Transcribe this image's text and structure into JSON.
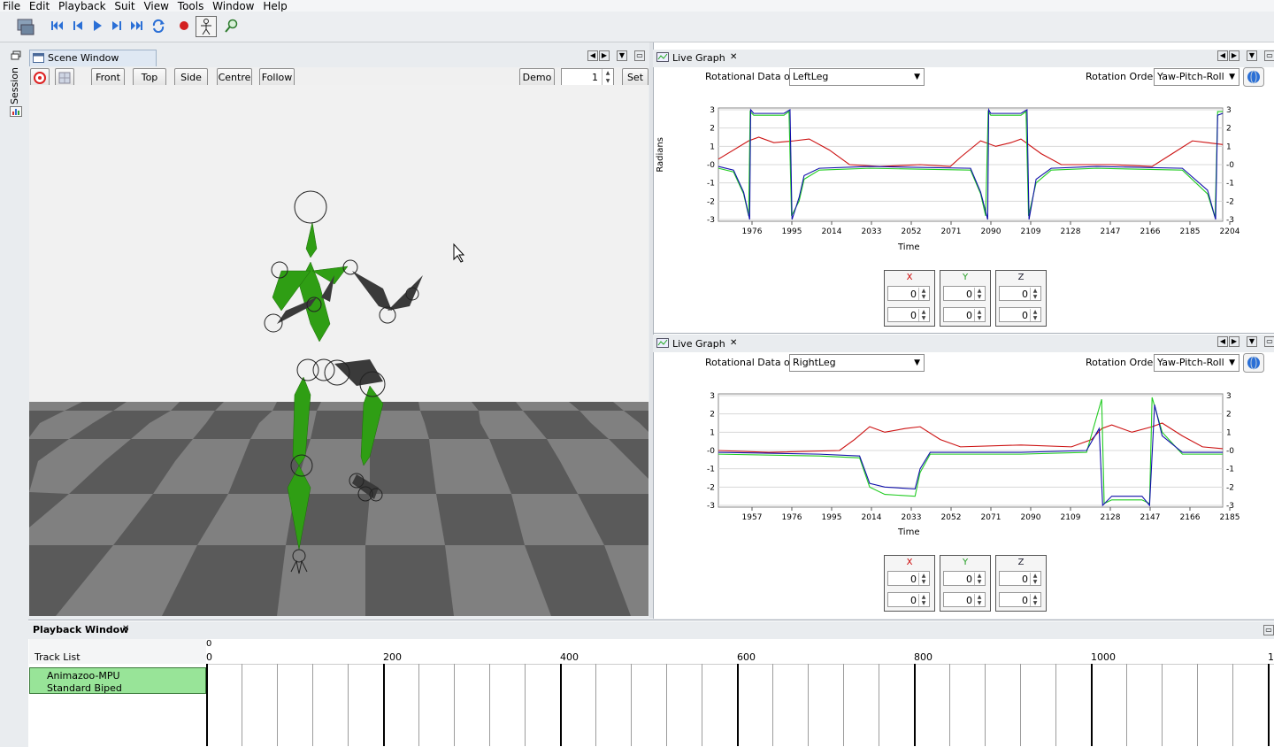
{
  "menu": [
    "File",
    "Edit",
    "Playback",
    "Suit",
    "View",
    "Tools",
    "Window",
    "Help"
  ],
  "sidebar": {
    "session_label": "Session"
  },
  "scene": {
    "tab_title": "Scene Window",
    "buttons": {
      "front": "Front",
      "top": "Top",
      "side": "Side",
      "centre": "Centre",
      "follow": "Follow",
      "demo": "Demo",
      "set": "Set"
    },
    "frame_value": "1"
  },
  "graph1": {
    "tab_title": "Live Graph",
    "rot_label": "Rotational Data of",
    "segment": "LeftLeg",
    "order_label": "Rotation Order",
    "order_value": "Yaw-Pitch-Roll",
    "ylabel": "Radians",
    "xlabel": "Time",
    "y_ticks": [
      "3",
      "2",
      "1",
      "-0",
      "-1",
      "-2",
      "-3"
    ],
    "x_ticks": [
      "1976",
      "1995",
      "2014",
      "2033",
      "2052",
      "2071",
      "2090",
      "2109",
      "2128",
      "2147",
      "2166",
      "2185",
      "2204"
    ],
    "xyz": {
      "x": "X",
      "y": "Y",
      "z": "Z",
      "vals": [
        "0",
        "0",
        "0",
        "0",
        "0",
        "0"
      ]
    }
  },
  "graph2": {
    "tab_title": "Live Graph",
    "rot_label": "Rotational Data of",
    "segment": "RightLeg",
    "order_label": "Rotation Order",
    "order_value": "Yaw-Pitch-Roll",
    "xlabel": "Time",
    "y_ticks": [
      "3",
      "2",
      "1",
      "-0",
      "-1",
      "-2",
      "-3"
    ],
    "x_ticks": [
      "1957",
      "1976",
      "1995",
      "2014",
      "2033",
      "2052",
      "2071",
      "2090",
      "2109",
      "2128",
      "2147",
      "2166",
      "2185"
    ],
    "xyz": {
      "x": "X",
      "y": "Y",
      "z": "Z",
      "vals": [
        "0",
        "0",
        "0",
        "0",
        "0",
        "0"
      ]
    }
  },
  "playback": {
    "title": "Playback Window",
    "track_list": "Track List",
    "track_line1": "Animazoo-MPU",
    "track_line2": "Standard Biped",
    "ruler": [
      "0",
      "200",
      "400",
      "600",
      "800",
      "1000",
      "1"
    ],
    "ruler_top": "0"
  },
  "colors": {
    "series_x": "#cc1111",
    "series_y": "#22cc22",
    "series_z": "#1111aa",
    "bone": "#2f9e14",
    "track": "#98e498"
  }
}
